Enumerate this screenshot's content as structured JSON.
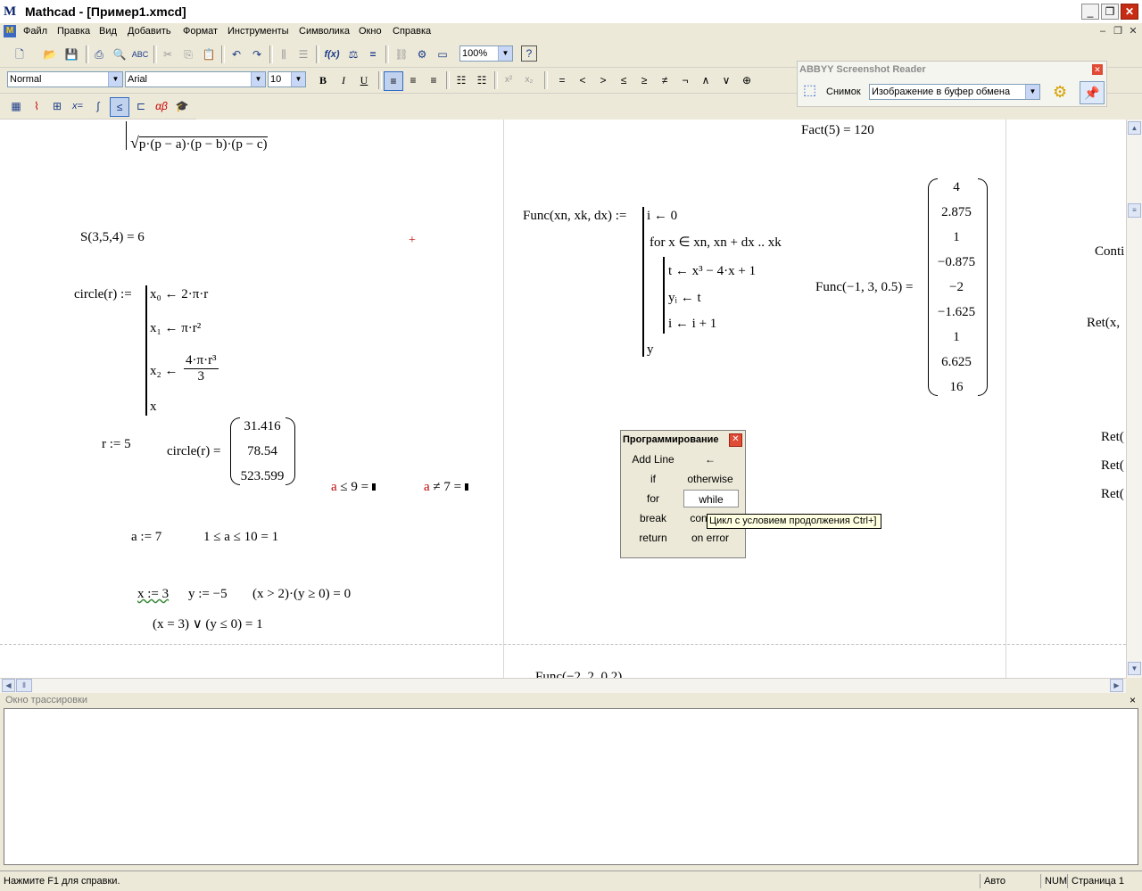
{
  "window": {
    "title": "Mathcad - [Пример1.xmcd]",
    "logo": "M"
  },
  "menu": [
    "Файл",
    "Правка",
    "Вид",
    "Добавить",
    "Формат",
    "Инструменты",
    "Символика",
    "Окно",
    "Справка"
  ],
  "format_toolbar": {
    "style": "Normal",
    "font": "Arial",
    "size": "10",
    "bold": "B",
    "italic": "I",
    "underline": "U"
  },
  "standard_toolbar": {
    "zoom": "100%"
  },
  "operators": [
    "=",
    "<",
    ">",
    "≤",
    "≥",
    "≠",
    "¬",
    "∧",
    "∨",
    "⊕"
  ],
  "math_toolbar": [
    "calc",
    "graph",
    "matrix",
    "x=",
    "calculus",
    "boolean",
    "programming",
    "αβ",
    "symbolic"
  ],
  "abbyy": {
    "title": "ABBYY Screenshot Reader",
    "snapshot_label": "Снимок",
    "mode": "Изображение в буфер обмена"
  },
  "worksheet": {
    "sqrt_expr": "p·(p − a)·(p − b)·(p − c)",
    "s_eval": "S(3,5,4)  =  6",
    "circle_def": "circle(r)  :=",
    "circle_lines": [
      "x₀ ← 2·π·r",
      "x₁ ← π·r²",
      "x₂ ←",
      "4·π·r³",
      "3",
      "x"
    ],
    "r_assign": "r  :=  5",
    "circle_eval": "circle(r)  =",
    "circle_result": [
      "31.416",
      "78.54",
      "523.599"
    ],
    "le_expr_var": "a",
    "le_expr": " ≤ 9 = ",
    "ne_expr_var": "a",
    "ne_expr": " ≠ 7 = ",
    "a_assign": "a  :=  7",
    "range_check": "1  ≤  a  ≤  10  =  1",
    "x_assign": "x := 3",
    "y_assign": "y := −5",
    "and_expr": "(x > 2)·(y ≥ 0)  =  0",
    "or_expr": "(x = 3) ∨ (y ≤ 0)  =  1",
    "fact_eval": "Fact(5)  =  120",
    "func_def": "Func(xn, xk, dx)  :=",
    "func_lines": [
      "i ← 0",
      "for  x ∈ xn, xn + dx .. xk",
      "t ← x³ − 4·x + 1",
      "yᵢ ← t",
      "i ← i + 1",
      "y"
    ],
    "func_eval": "Func(−1, 3, 0.5)  =",
    "func_result": [
      "4",
      "2.875",
      "1",
      "−0.875",
      "−2",
      "−1.625",
      "1",
      "6.625",
      "16"
    ],
    "bottom_cut": "Func(−2, 2, 0.2)",
    "right_col": [
      "Conti",
      "Ret(x,",
      "Ret(",
      "Ret(",
      "Ret("
    ]
  },
  "palette": {
    "title": "Программирование",
    "buttons": [
      "Add Line",
      "←",
      "if",
      "otherwise",
      "for",
      "while",
      "break",
      "continue",
      "return",
      "on error"
    ],
    "tooltip": "Цикл с условием продолжения  Ctrl+]"
  },
  "trace": {
    "title": "Окно трассировки"
  },
  "status": {
    "help": "Нажмите F1 для справки.",
    "mode": "Авто",
    "num": "NUM",
    "page": "Страница 1"
  }
}
